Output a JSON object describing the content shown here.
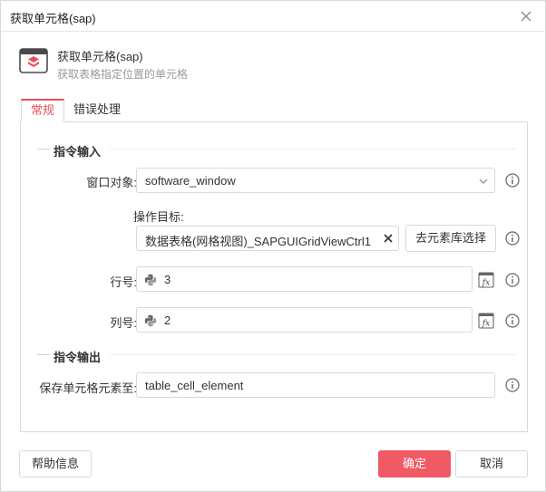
{
  "window": {
    "title": "获取单元格(sap)"
  },
  "header": {
    "title": "获取单元格(sap)",
    "description": "获取表格指定位置的单元格"
  },
  "tabs": [
    {
      "label": "常规"
    },
    {
      "label": "错误处理"
    }
  ],
  "sections": {
    "input": "指令输入",
    "output": "指令输出"
  },
  "fields": {
    "window_object": {
      "label": "窗口对象:",
      "value": "software_window"
    },
    "target": {
      "label": "操作目标:",
      "value": "数据表格(网格视图)_SAPGUIGridViewCtrl1",
      "button": "去元素库选择"
    },
    "row": {
      "label": "行号:",
      "value": "3"
    },
    "col": {
      "label": "列号:",
      "value": "2"
    },
    "save_to": {
      "label": "保存单元格元素至:",
      "value": "table_cell_element"
    }
  },
  "footer": {
    "help": "帮助信息",
    "ok": "确定",
    "cancel": "取消"
  },
  "colors": {
    "accent": "#e8505b",
    "primary_button": "#f05a64"
  }
}
